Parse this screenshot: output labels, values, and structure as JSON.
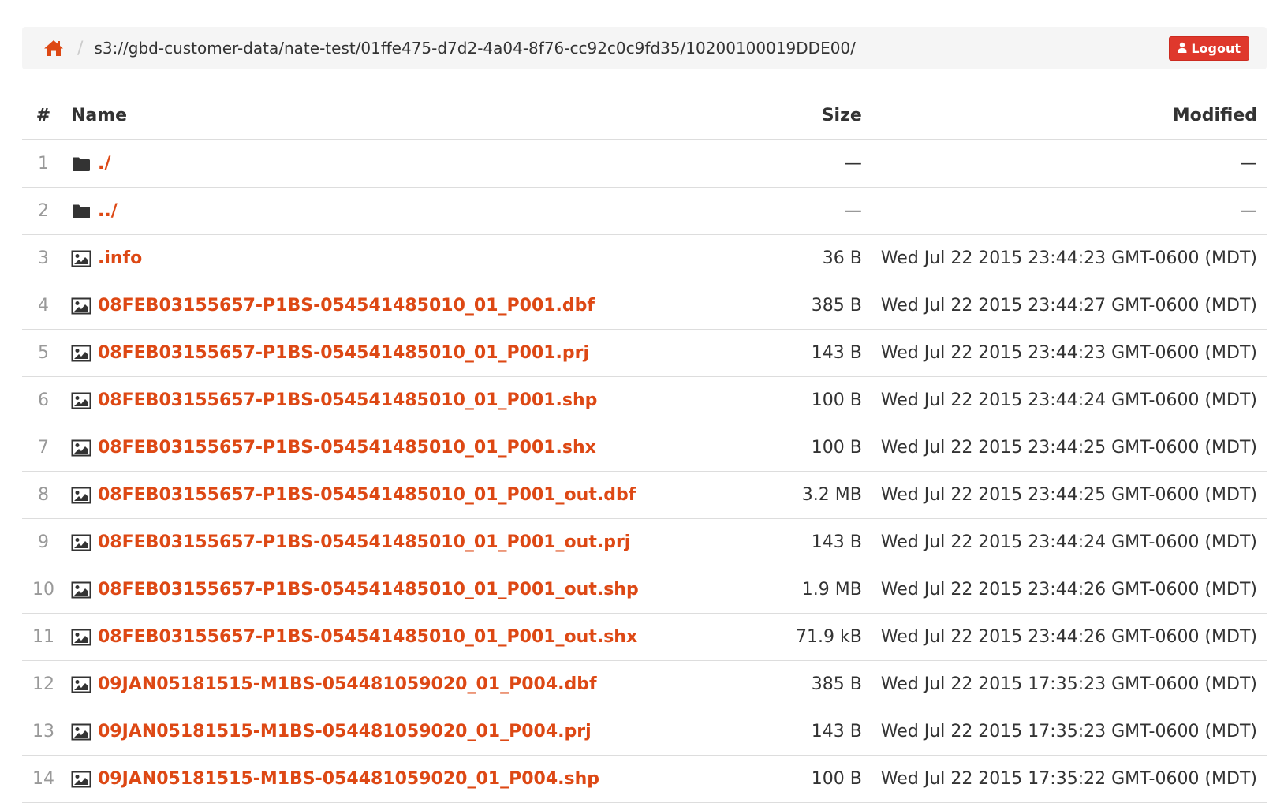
{
  "breadcrumb": {
    "path": "s3://gbd-customer-data/nate-test/01ffe475-d7d2-4a04-8f76-cc92c0c9fd35/10200100019DDE00/",
    "separator": "/",
    "logout_label": "Logout"
  },
  "table": {
    "headers": {
      "num": "#",
      "name": "Name",
      "size": "Size",
      "modified": "Modified"
    },
    "rows": [
      {
        "num": "1",
        "icon": "folder-icon",
        "name": "./",
        "size": "—",
        "modified": "—"
      },
      {
        "num": "2",
        "icon": "folder-icon",
        "name": "../",
        "size": "—",
        "modified": "—"
      },
      {
        "num": "3",
        "icon": "image-file-icon",
        "name": ".info",
        "size": "36 B",
        "modified": "Wed Jul 22 2015 23:44:23 GMT-0600 (MDT)"
      },
      {
        "num": "4",
        "icon": "image-file-icon",
        "name": "08FEB03155657-P1BS-054541485010_01_P001.dbf",
        "size": "385 B",
        "modified": "Wed Jul 22 2015 23:44:27 GMT-0600 (MDT)"
      },
      {
        "num": "5",
        "icon": "image-file-icon",
        "name": "08FEB03155657-P1BS-054541485010_01_P001.prj",
        "size": "143 B",
        "modified": "Wed Jul 22 2015 23:44:23 GMT-0600 (MDT)"
      },
      {
        "num": "6",
        "icon": "image-file-icon",
        "name": "08FEB03155657-P1BS-054541485010_01_P001.shp",
        "size": "100 B",
        "modified": "Wed Jul 22 2015 23:44:24 GMT-0600 (MDT)"
      },
      {
        "num": "7",
        "icon": "image-file-icon",
        "name": "08FEB03155657-P1BS-054541485010_01_P001.shx",
        "size": "100 B",
        "modified": "Wed Jul 22 2015 23:44:25 GMT-0600 (MDT)"
      },
      {
        "num": "8",
        "icon": "image-file-icon",
        "name": "08FEB03155657-P1BS-054541485010_01_P001_out.dbf",
        "size": "3.2 MB",
        "modified": "Wed Jul 22 2015 23:44:25 GMT-0600 (MDT)"
      },
      {
        "num": "9",
        "icon": "image-file-icon",
        "name": "08FEB03155657-P1BS-054541485010_01_P001_out.prj",
        "size": "143 B",
        "modified": "Wed Jul 22 2015 23:44:24 GMT-0600 (MDT)"
      },
      {
        "num": "10",
        "icon": "image-file-icon",
        "name": "08FEB03155657-P1BS-054541485010_01_P001_out.shp",
        "size": "1.9 MB",
        "modified": "Wed Jul 22 2015 23:44:26 GMT-0600 (MDT)"
      },
      {
        "num": "11",
        "icon": "image-file-icon",
        "name": "08FEB03155657-P1BS-054541485010_01_P001_out.shx",
        "size": "71.9 kB",
        "modified": "Wed Jul 22 2015 23:44:26 GMT-0600 (MDT)"
      },
      {
        "num": "12",
        "icon": "image-file-icon",
        "name": "09JAN05181515-M1BS-054481059020_01_P004.dbf",
        "size": "385 B",
        "modified": "Wed Jul 22 2015 17:35:23 GMT-0600 (MDT)"
      },
      {
        "num": "13",
        "icon": "image-file-icon",
        "name": "09JAN05181515-M1BS-054481059020_01_P004.prj",
        "size": "143 B",
        "modified": "Wed Jul 22 2015 17:35:23 GMT-0600 (MDT)"
      },
      {
        "num": "14",
        "icon": "image-file-icon",
        "name": "09JAN05181515-M1BS-054481059020_01_P004.shp",
        "size": "100 B",
        "modified": "Wed Jul 22 2015 17:35:22 GMT-0600 (MDT)"
      }
    ]
  },
  "colors": {
    "accent": "#dd4814",
    "logout_bg": "#df382c",
    "breadcrumb_bg": "#f5f5f5",
    "row_border": "#dddddd"
  }
}
